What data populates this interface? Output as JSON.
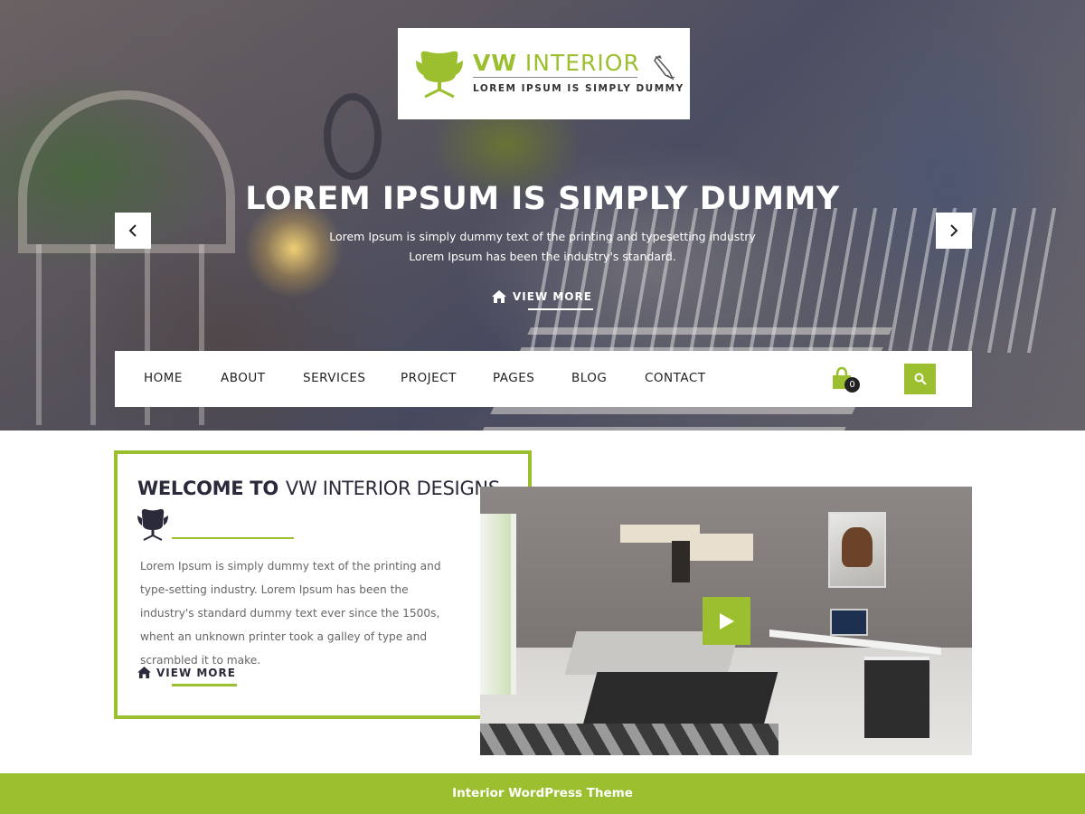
{
  "brand": {
    "name_bold": "VW",
    "name_light": "INTERIOR",
    "tagline": "LOREM IPSUM IS SIMPLY DUMMY",
    "icons": [
      "chair-icon",
      "pen-icon"
    ]
  },
  "hero": {
    "title": "LOREM IPSUM IS SIMPLY DUMMY",
    "line1": "Lorem Ipsum is simply dummy text of the printing and typesetting industry",
    "line2": "Lorem Ipsum has been the industry's standard.",
    "button_label": "VIEW MORE",
    "prev_icon": "chevron-left-icon",
    "next_icon": "chevron-right-icon"
  },
  "nav": {
    "items": [
      {
        "label": "HOME"
      },
      {
        "label": "ABOUT"
      },
      {
        "label": "SERVICES"
      },
      {
        "label": "PROJECT"
      },
      {
        "label": "PAGES"
      },
      {
        "label": "BLOG"
      },
      {
        "label": "CONTACT"
      }
    ],
    "cart_count": "0",
    "cart_icon": "shopping-bag-icon",
    "search_icon": "search-icon"
  },
  "welcome": {
    "title_bold": "WELCOME TO",
    "title_light": "VW INTERIOR DESIGNS",
    "body": "Lorem Ipsum is simply dummy text of the printing and type-setting industry. Lorem Ipsum has been the industry's standard dummy text ever since the 1500s, whent an unknown printer took a galley of type and scrambled it to make.",
    "button_label": "VIEW MORE",
    "play_icon": "play-icon"
  },
  "footer": {
    "text": "Interior WordPress Theme"
  },
  "colors": {
    "accent": "#9bbf2e",
    "dark_text": "#2a2a3a",
    "body_text": "#666666"
  }
}
